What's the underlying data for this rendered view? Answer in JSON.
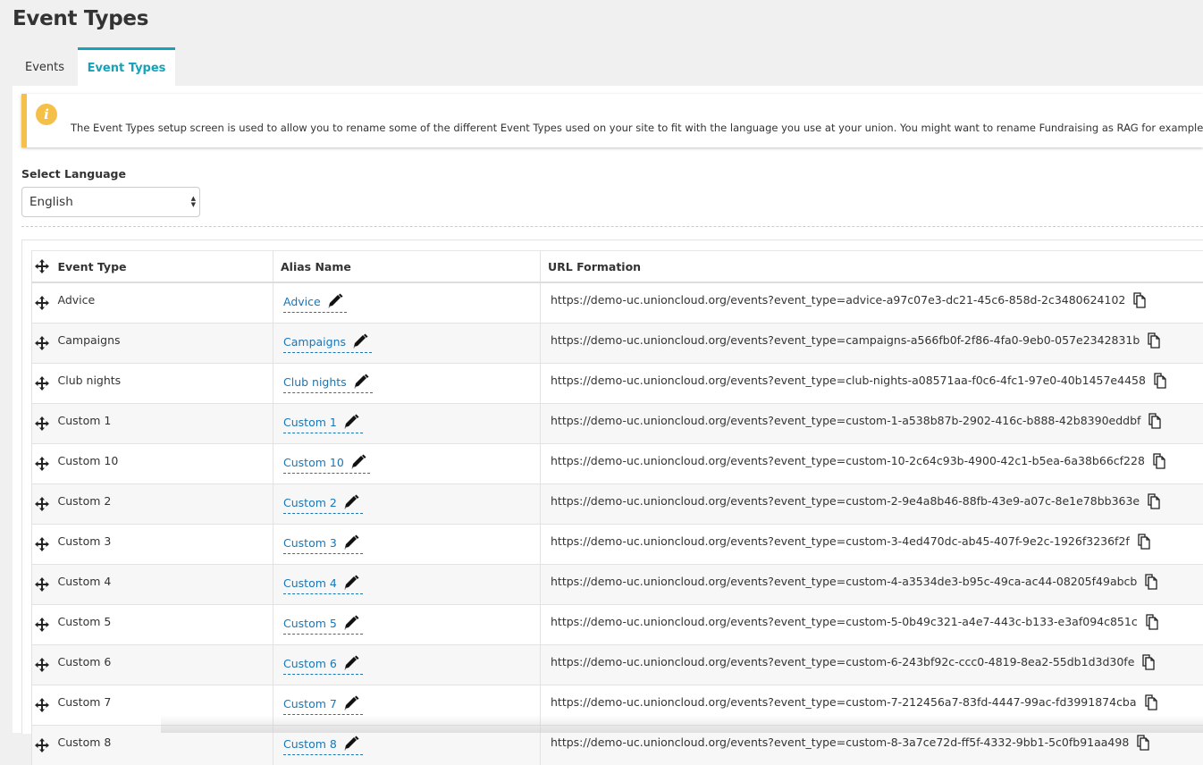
{
  "page": {
    "title": "Event Types"
  },
  "tabs": [
    {
      "label": "Events",
      "active": false
    },
    {
      "label": "Event Types",
      "active": true
    }
  ],
  "alert": {
    "icon": "info-icon",
    "text": "The Event Types setup screen is used to allow you to rename some of the different Event Types used on your site to fit with the language you use at your union. You might want to rename Fundraising as RAG for example. For more"
  },
  "language": {
    "label": "Select Language",
    "selected": "English"
  },
  "table": {
    "headers": {
      "event_type": "Event Type",
      "alias_name": "Alias Name",
      "url_formation": "URL Formation"
    },
    "rows": [
      {
        "event_type": "Advice",
        "alias": "Advice",
        "url": "https://demo-uc.unioncloud.org/events?event_type=advice-a97c07e3-dc21-45c6-858d-2c3480624102"
      },
      {
        "event_type": "Campaigns",
        "alias": "Campaigns",
        "url": "https://demo-uc.unioncloud.org/events?event_type=campaigns-a566fb0f-2f86-4fa0-9eb0-057e2342831b"
      },
      {
        "event_type": "Club nights",
        "alias": "Club nights",
        "url": "https://demo-uc.unioncloud.org/events?event_type=club-nights-a08571aa-f0c6-4fc1-97e0-40b1457e4458"
      },
      {
        "event_type": "Custom 1",
        "alias": "Custom 1",
        "url": "https://demo-uc.unioncloud.org/events?event_type=custom-1-a538b87b-2902-416c-b888-42b8390eddbf"
      },
      {
        "event_type": "Custom 10",
        "alias": "Custom 10",
        "url": "https://demo-uc.unioncloud.org/events?event_type=custom-10-2c64c93b-4900-42c1-b5ea-6a38b66cf228"
      },
      {
        "event_type": "Custom 2",
        "alias": "Custom 2",
        "url": "https://demo-uc.unioncloud.org/events?event_type=custom-2-9e4a8b46-88fb-43e9-a07c-8e1e78bb363e"
      },
      {
        "event_type": "Custom 3",
        "alias": "Custom 3",
        "url": "https://demo-uc.unioncloud.org/events?event_type=custom-3-4ed470dc-ab45-407f-9e2c-1926f3236f2f"
      },
      {
        "event_type": "Custom 4",
        "alias": "Custom 4",
        "url": "https://demo-uc.unioncloud.org/events?event_type=custom-4-a3534de3-b95c-49ca-ac44-08205f49abcb"
      },
      {
        "event_type": "Custom 5",
        "alias": "Custom 5",
        "url": "https://demo-uc.unioncloud.org/events?event_type=custom-5-0b49c321-a4e7-443c-b133-e3af094c851c"
      },
      {
        "event_type": "Custom 6",
        "alias": "Custom 6",
        "url": "https://demo-uc.unioncloud.org/events?event_type=custom-6-243bf92c-ccc0-4819-8ea2-55db1d3d30fe"
      },
      {
        "event_type": "Custom 7",
        "alias": "Custom 7",
        "url": "https://demo-uc.unioncloud.org/events?event_type=custom-7-212456a7-83fd-4447-99ac-fd3991874cba"
      },
      {
        "event_type": "Custom 8",
        "alias": "Custom 8",
        "url": "https://demo-uc.unioncloud.org/events?event_type=custom-8-3a7ce72d-ff5f-4332-9bb1-5c0fb91aa498"
      }
    ]
  },
  "colors": {
    "accent": "#16a2b8",
    "link": "#1a76b5",
    "alert_border": "#f5c04a"
  }
}
